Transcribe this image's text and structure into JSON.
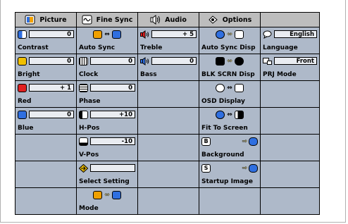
{
  "headers": [
    {
      "label": "Picture",
      "icon": "picture-icon"
    },
    {
      "label": "Fine Sync",
      "icon": "fine-sync-icon"
    },
    {
      "label": "Audio",
      "icon": "speaker-icon"
    },
    {
      "label": "Options",
      "icon": "options-icon"
    }
  ],
  "picture": {
    "contrast": {
      "label": "Contrast",
      "value": "0"
    },
    "bright": {
      "label": "Bright",
      "value": "0"
    },
    "red": {
      "label": "Red",
      "value": "+ 1"
    },
    "blue": {
      "label": "Blue",
      "value": "0"
    }
  },
  "fine_sync": {
    "auto_sync": {
      "label": "Auto Sync"
    },
    "clock": {
      "label": "Clock",
      "value": "0"
    },
    "phase": {
      "label": "Phase",
      "value": "0"
    },
    "hpos": {
      "label": "H-Pos",
      "value": "+10"
    },
    "vpos": {
      "label": "V-Pos",
      "value": "-10"
    },
    "select_setting": {
      "label": "Select Setting",
      "value": ""
    },
    "mode": {
      "label": "Mode"
    }
  },
  "audio": {
    "treble": {
      "label": "Treble",
      "value": "+ 5"
    },
    "bass": {
      "label": "Bass",
      "value": "0"
    }
  },
  "options": {
    "auto_sync_disp": {
      "label": "Auto Sync Disp"
    },
    "blk_scrn_disp": {
      "label": "BLK SCRN Disp"
    },
    "osd_display": {
      "label": "OSD Display"
    },
    "fit_to_screen": {
      "label": "Fit To Screen"
    },
    "background": {
      "label": "Background"
    },
    "startup_image": {
      "label": "Startup Image"
    }
  },
  "lang_col": {
    "language": {
      "label": "Language",
      "value": "English"
    },
    "prj_mode": {
      "label": "PRJ Mode",
      "value": "Front"
    }
  },
  "colors": {
    "cell_bg": "#aeb9c9",
    "header_bg": "#bdbdbd",
    "value_box": "#e9ecf1",
    "accent_blue": "#2f6fe0",
    "accent_red": "#e02020",
    "accent_yellow": "#f0a000"
  }
}
